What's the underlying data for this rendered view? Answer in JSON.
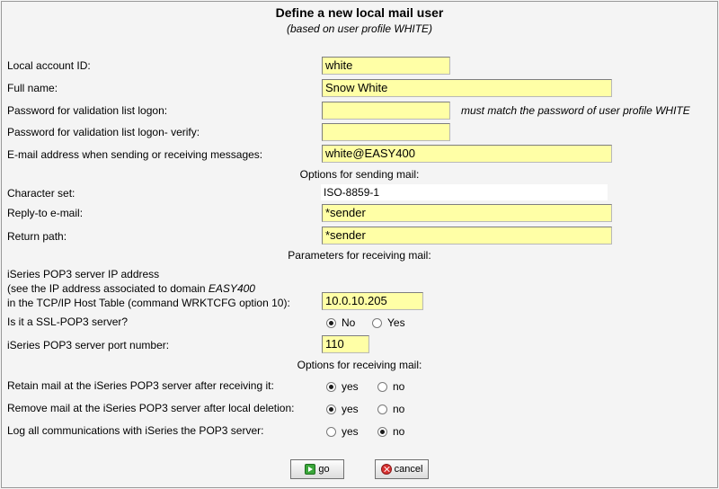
{
  "header": {
    "title": "Define a new local mail user",
    "subtitle": "(based on user profile WHITE)"
  },
  "fields": {
    "account_id": {
      "label": "Local account ID:",
      "value": "white"
    },
    "full_name": {
      "label": "Full name:",
      "value": "Snow White"
    },
    "password": {
      "label": "Password for validation list logon:",
      "value": "",
      "hint": "must match the password of user profile WHITE"
    },
    "password_verify": {
      "label": "Password for validation list logon- verify:",
      "value": ""
    },
    "email": {
      "label": "E-mail address when sending or receiving messages:",
      "value": "white@EASY400"
    }
  },
  "sending": {
    "heading": "Options for sending mail:",
    "charset": {
      "label": "Character set:",
      "value": "ISO-8859-1"
    },
    "reply_to": {
      "label": "Reply-to e-mail:",
      "value": "*sender"
    },
    "return_path": {
      "label": "Return path:",
      "value": "*sender"
    }
  },
  "receiving_params": {
    "heading": "Parameters for receiving mail:",
    "ip_label_1": "iSeries POP3 server IP address",
    "ip_label_2a": "(see the IP address associated to domain ",
    "ip_label_2b": "EASY400",
    "ip_label_3": "in the TCP/IP Host Table (command WRKTCFG option 10):",
    "ip_value": "10.0.10.205",
    "ssl_label": "Is it a SSL-POP3 server?",
    "ssl_no": "No",
    "ssl_yes": "Yes",
    "ssl_selected": "No",
    "port_label": "iSeries POP3 server port number:",
    "port_value": "110"
  },
  "receiving_options": {
    "heading": "Options for receiving mail:",
    "retain": {
      "label": "Retain mail at the iSeries POP3 server after receiving it:",
      "yes": "yes",
      "no": "no",
      "selected": "yes"
    },
    "remove": {
      "label": "Remove mail at the iSeries POP3 server after local deletion:",
      "yes": "yes",
      "no": "no",
      "selected": "yes"
    },
    "log": {
      "label": "Log all communications with iSeries the POP3 server:",
      "yes": "yes",
      "no": "no",
      "selected": "no"
    }
  },
  "buttons": {
    "go": "go",
    "cancel": "cancel"
  }
}
